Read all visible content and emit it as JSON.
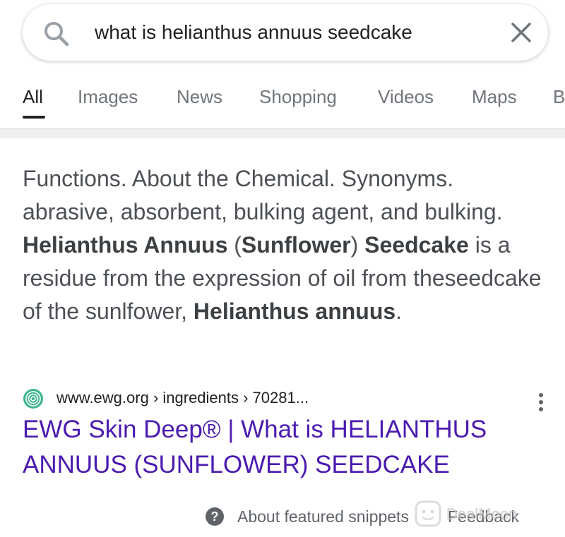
{
  "search": {
    "query": "what is helianthus annuus seedcake"
  },
  "tabs": [
    {
      "label": "All",
      "active": true
    },
    {
      "label": "Images",
      "active": false
    },
    {
      "label": "News",
      "active": false
    },
    {
      "label": "Shopping",
      "active": false
    },
    {
      "label": "Videos",
      "active": false
    },
    {
      "label": "Maps",
      "active": false
    },
    {
      "label": "B",
      "active": false
    }
  ],
  "snippet": {
    "parts": [
      {
        "text": "Functions. About the Chemical. Synonyms. abrasive, absorbent, bulking agent, and bulking. ",
        "bold": false
      },
      {
        "text": "Helianthus Annuus",
        "bold": true
      },
      {
        "text": " (",
        "bold": false
      },
      {
        "text": "Sunflower",
        "bold": true
      },
      {
        "text": ") ",
        "bold": false
      },
      {
        "text": "Seedcake",
        "bold": true
      },
      {
        "text": " is a residue from the expression of oil from theseedcake of the sunlfower, ",
        "bold": false
      },
      {
        "text": "Helianthus annuus",
        "bold": true
      },
      {
        "text": ".",
        "bold": false
      }
    ]
  },
  "result": {
    "source_url": "www.ewg.org › ingredients › 70281...",
    "title": "EWG Skin Deep® | What is HELIANTHUS ANNUUS (SUNFLOWER) SEEDCAKE",
    "favicon": "ewg-favicon-icon",
    "title_color": "#4b1bb0"
  },
  "footer": {
    "about_label": "About featured snippets",
    "feedback_label": "Feedback"
  },
  "watermark": {
    "text": "DealMoon"
  },
  "icons": {
    "search": "search-icon",
    "clear": "close-icon",
    "more": "more-vert-icon",
    "help": "help-icon"
  }
}
